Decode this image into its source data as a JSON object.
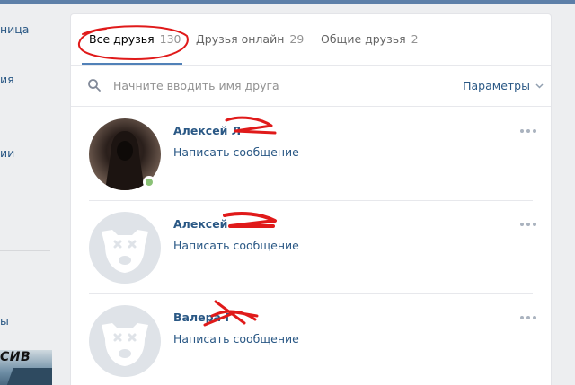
{
  "sidebar": {
    "items": [
      {
        "label": "ница"
      },
      {
        "label": "ия"
      },
      {
        "label": "ии"
      },
      {
        "label": "ы"
      }
    ],
    "promo_text": "СИВ"
  },
  "tabs": [
    {
      "label": "Все друзья",
      "count": "130",
      "active": true
    },
    {
      "label": "Друзья онлайн",
      "count": "29",
      "active": false
    },
    {
      "label": "Общие друзья",
      "count": "2",
      "active": false
    }
  ],
  "search": {
    "placeholder": "Начните вводить имя друга",
    "icon": "search-icon",
    "params_label": "Параметры",
    "params_icon": "chevron-down-icon"
  },
  "friends": [
    {
      "name": "Алексей Л",
      "action": "Написать сообщение",
      "avatar": "photo",
      "online": true
    },
    {
      "name": "Алексей",
      "action": "Написать сообщение",
      "avatar": "default-dog",
      "online": false
    },
    {
      "name": "Валера Г",
      "action": "Написать сообщение",
      "avatar": "default-dog",
      "online": false
    }
  ],
  "colors": {
    "accent": "#5181b8",
    "link": "#2a5885",
    "online": "#8ac176",
    "annotation": "#e01a1a"
  }
}
